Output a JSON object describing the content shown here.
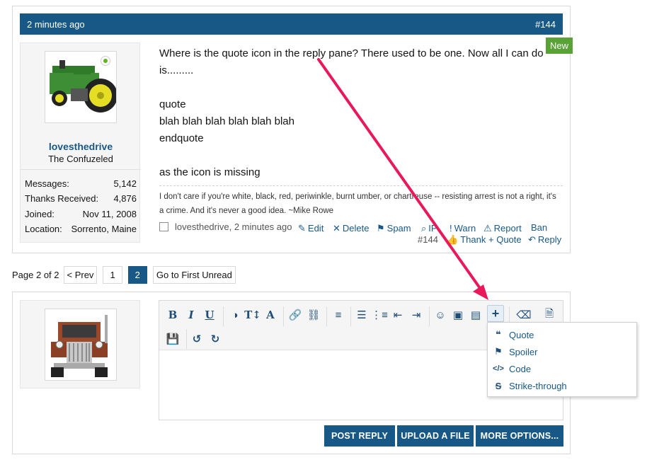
{
  "post": {
    "time": "2 minutes ago",
    "number": "#144",
    "new_badge": "New",
    "user": {
      "name": "lovesthedrive",
      "title": "The Confuzeled",
      "stats": [
        {
          "label": "Messages:",
          "value": "5,142"
        },
        {
          "label": "Thanks Received:",
          "value": "4,876"
        },
        {
          "label": "Joined:",
          "value": "Nov 11, 2008"
        },
        {
          "label": "Location:",
          "value": "Sorrento, Maine"
        }
      ]
    },
    "body_lines": [
      "Where is the quote icon in the reply pane? There used to be one. Now all I can do",
      "is.........",
      "",
      "quote",
      "blah blah blah blah blah blah",
      "endquote",
      "",
      "as the icon is missing"
    ],
    "signature_line1": "I don't care if you're white, black, red, periwinkle, burnt umber, or chartreuse -- resisting arrest is not a right, it's",
    "signature_line2": "a crime. And it's never a good idea. ~Mike Rowe",
    "meta": "lovesthedrive, 2 minutes ago",
    "actions": {
      "edit": "Edit",
      "delete": "Delete",
      "spam": "Spam",
      "ip": "IP",
      "warn": "Warn",
      "report": "Report",
      "ban": "Ban",
      "number": "#144",
      "thank": "Thank",
      "quote": "+ Quote",
      "reply": "Reply"
    }
  },
  "pagination": {
    "label": "Page 2 of 2",
    "prev": "< Prev",
    "pages": [
      "1",
      "2"
    ],
    "current": "2",
    "first_unread": "Go to First Unread"
  },
  "editor": {
    "buttons": {
      "post_reply": "POST REPLY",
      "upload": "UPLOAD A FILE",
      "more": "MORE OPTIONS..."
    },
    "toolbar_icons": [
      "bold-icon",
      "italic-icon",
      "underline-icon",
      "color-icon",
      "text-size-icon",
      "font-icon",
      "link-icon",
      "unlink-icon",
      "align-icon",
      "bullet-list-icon",
      "numbered-list-icon",
      "outdent-icon",
      "indent-icon",
      "smilie-icon",
      "image-icon",
      "media-icon",
      "insert-plus-icon",
      "remove-format-icon",
      "source-icon",
      "save-icon",
      "undo-icon",
      "redo-icon"
    ],
    "dropdown": [
      "Quote",
      "Spoiler",
      "Code",
      "Strike-through"
    ]
  },
  "colors": {
    "accent": "#185886",
    "new_badge": "#59a235",
    "arrow": "#e8185a"
  }
}
